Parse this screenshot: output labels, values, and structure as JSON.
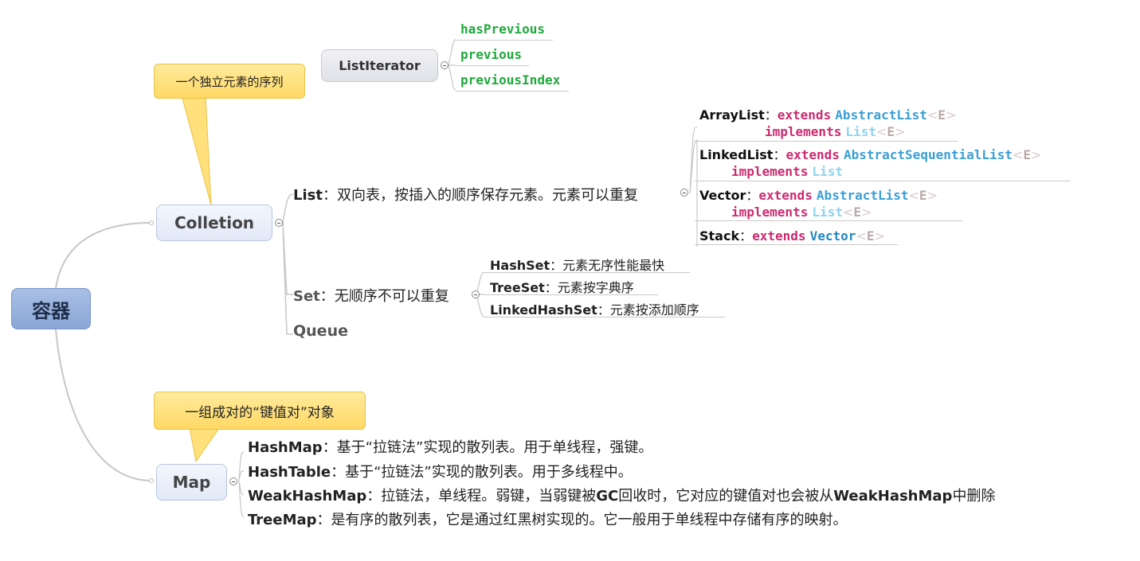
{
  "root": "容器",
  "collection": {
    "label": "Colletion",
    "note": "一个独立元素的序列",
    "list": {
      "label": "List",
      "desc": "：双向表，按插入的顺序保存元素。元素可以重复",
      "children": [
        {
          "name": "ArrayList",
          "sep": "：",
          "extends_kw": "extends",
          "extends_type": "AbstractList",
          "extends_generic": "E",
          "implements_kw": "implements",
          "implements_type": "List",
          "implements_generic": "E"
        },
        {
          "name": "LinkedList",
          "sep": "：",
          "extends_kw": "extends",
          "extends_type": "AbstractSequentialList",
          "extends_generic": "E",
          "implements_kw": "implements",
          "implements_type": "List"
        },
        {
          "name": "Vector",
          "sep": "：",
          "extends_kw": "extends",
          "extends_type": "AbstractList",
          "extends_generic": "E",
          "implements_kw": "implements",
          "implements_type": "List",
          "implements_generic": "E"
        },
        {
          "name": "Stack",
          "sep": "：",
          "extends_kw": "extends",
          "extends_type": "Vector",
          "extends_generic": "E"
        }
      ]
    },
    "set": {
      "label": "Set",
      "desc": "：无顺序不可以重复",
      "children": [
        {
          "name": "HashSet",
          "desc": "：元素无序性能最快"
        },
        {
          "name": "TreeSet",
          "desc": "：元素按字典序"
        },
        {
          "name": "LinkedHashSet",
          "desc": "：元素按添加顺序"
        }
      ]
    },
    "queue": {
      "label": "Queue"
    }
  },
  "list_iterator": {
    "label": "ListIterator",
    "methods": [
      "hasPrevious",
      "previous",
      "previousIndex"
    ]
  },
  "map": {
    "label": "Map",
    "note": "一组成对的“键值对”对象",
    "children": [
      {
        "name": "HashMap",
        "desc": "：基于“拉链法”实现的散列表。用于单线程，强键。"
      },
      {
        "name": "HashTable",
        "desc": "：基于“拉链法”实现的散列表。用于多线程中。"
      },
      {
        "name": "WeakHashMap",
        "desc_a": "：拉链法，单线程。弱键，当弱键被",
        "gc": "GC",
        "desc_b": "回收时，它对应的键值对也会被从",
        "name2": "WeakHashMap",
        "desc_c": "中删除"
      },
      {
        "name": "TreeMap",
        "desc": "：是有序的散列表，它是通过红黑树实现的。它一般用于单线程中存储有序的映射。"
      }
    ]
  },
  "colors": {
    "root": "#8aa6d6",
    "main_node": "#e2e9f7",
    "note": "#ffd866",
    "keyword": "#cc2a6f",
    "type": "#3a9fd6",
    "method": "#1fa93b"
  }
}
